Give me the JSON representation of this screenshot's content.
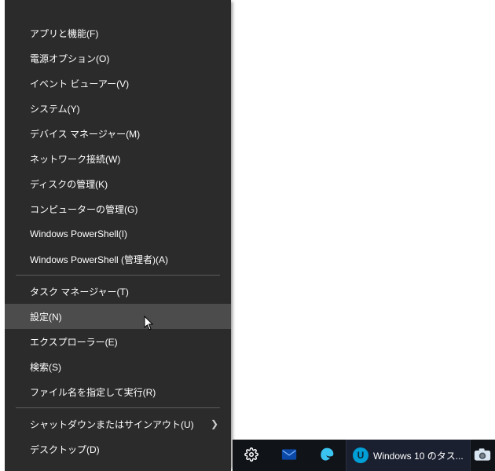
{
  "menu": {
    "groups": [
      [
        {
          "label": "アプリと機能(F)",
          "name": "menu-apps-and-features",
          "submenu": false
        },
        {
          "label": "電源オプション(O)",
          "name": "menu-power-options",
          "submenu": false
        },
        {
          "label": "イベント ビューアー(V)",
          "name": "menu-event-viewer",
          "submenu": false
        },
        {
          "label": "システム(Y)",
          "name": "menu-system",
          "submenu": false
        },
        {
          "label": "デバイス マネージャー(M)",
          "name": "menu-device-manager",
          "submenu": false
        },
        {
          "label": "ネットワーク接続(W)",
          "name": "menu-network-connections",
          "submenu": false
        },
        {
          "label": "ディスクの管理(K)",
          "name": "menu-disk-management",
          "submenu": false
        },
        {
          "label": "コンピューターの管理(G)",
          "name": "menu-computer-management",
          "submenu": false
        },
        {
          "label": "Windows PowerShell(I)",
          "name": "menu-powershell",
          "submenu": false
        },
        {
          "label": "Windows PowerShell (管理者)(A)",
          "name": "menu-powershell-admin",
          "submenu": false
        }
      ],
      [
        {
          "label": "タスク マネージャー(T)",
          "name": "menu-task-manager",
          "submenu": false
        },
        {
          "label": "設定(N)",
          "name": "menu-settings",
          "submenu": false,
          "hovered": true
        },
        {
          "label": "エクスプローラー(E)",
          "name": "menu-file-explorer",
          "submenu": false
        },
        {
          "label": "検索(S)",
          "name": "menu-search",
          "submenu": false
        },
        {
          "label": "ファイル名を指定して実行(R)",
          "name": "menu-run",
          "submenu": false
        }
      ],
      [
        {
          "label": "シャットダウンまたはサインアウト(U)",
          "name": "menu-shutdown-signout",
          "submenu": true
        },
        {
          "label": "デスクトップ(D)",
          "name": "menu-desktop",
          "submenu": false
        }
      ]
    ]
  },
  "taskbar": {
    "settings_icon": "settings-icon",
    "mail_icon": "mail-icon",
    "edge_icon": "edge-icon",
    "app_button": {
      "label": "Windows 10 のタス...",
      "badge_letter": "U",
      "badge_bg": "#009fd6",
      "badge_fg": "#0b2537"
    },
    "snip_icon": "snipping-icon"
  },
  "colors": {
    "menu_bg": "#2b2b2b",
    "menu_hover": "#4c4c4c",
    "taskbar_bg": "#101318",
    "edge_blue": "#3cc4f0"
  }
}
